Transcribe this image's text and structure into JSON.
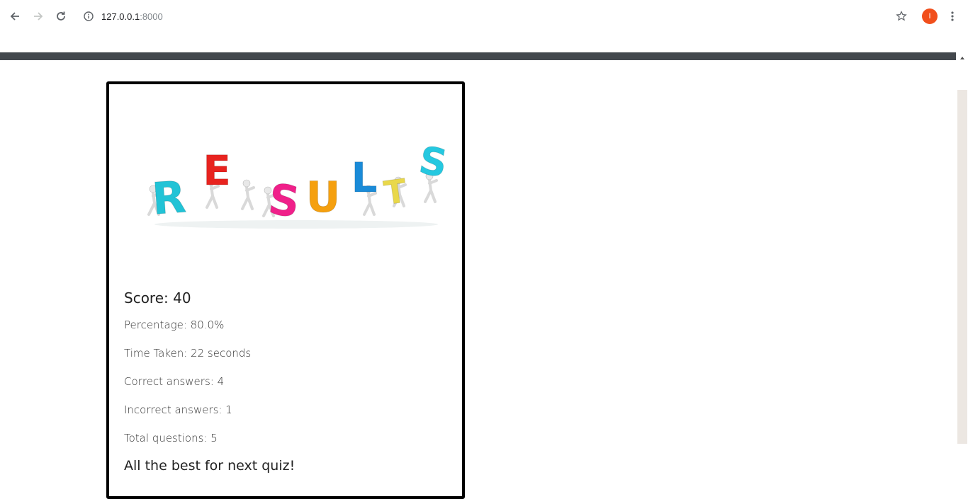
{
  "browser": {
    "url_host": "127.0.0.1",
    "url_port": ":8000",
    "avatar_initial": "I"
  },
  "banner": {
    "letters": [
      "R",
      "E",
      "S",
      "U",
      "L",
      "T",
      "S"
    ],
    "letter_colors": [
      "#22c3d6",
      "#e8231f",
      "#f0208a",
      "#f5a00f",
      "#1a8bd8",
      "#e9d84a",
      "#25c8e0"
    ]
  },
  "results": {
    "score": "Score: 40",
    "percentage": "Percentage: 80.0%",
    "time_taken": "Time Taken: 22 seconds",
    "correct": "Correct answers: 4",
    "incorrect": "Incorrect answers: 1",
    "total": "Total questions: 5",
    "farewell": "All the best for next quiz!"
  }
}
